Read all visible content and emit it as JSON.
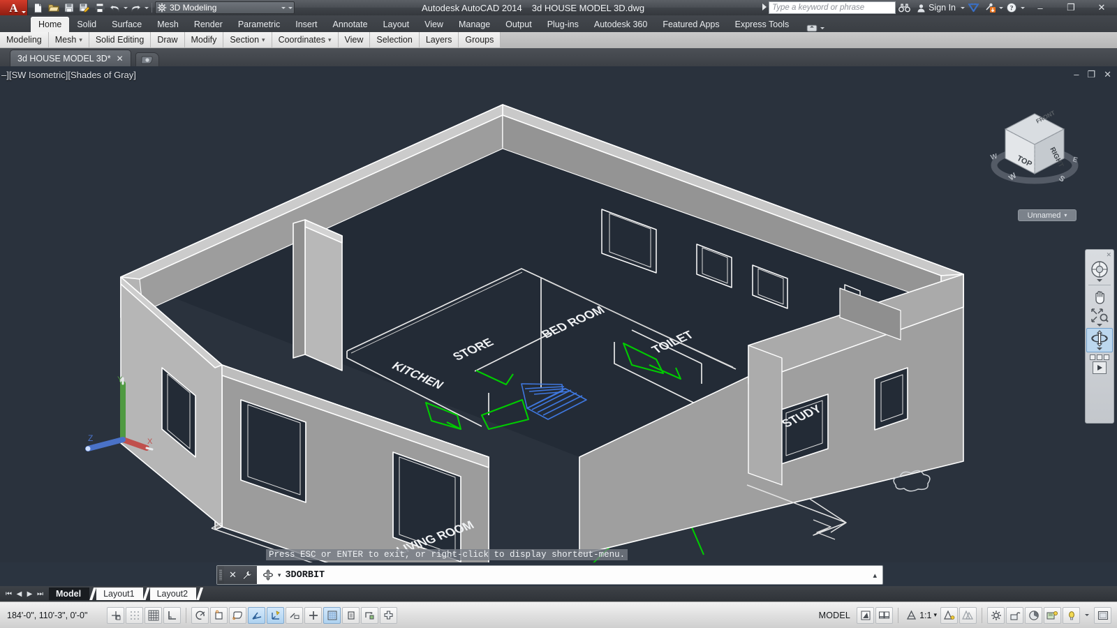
{
  "app": {
    "logo_letter": "A",
    "window_title": "Autodesk AutoCAD 2014",
    "document_title": "3d HOUSE MODEL 3D.dwg"
  },
  "quick_access": {
    "items": [
      {
        "name": "new-icon",
        "tooltip": "New"
      },
      {
        "name": "open-icon",
        "tooltip": "Open"
      },
      {
        "name": "save-icon",
        "tooltip": "Save"
      },
      {
        "name": "save-as-icon",
        "tooltip": "Save As"
      },
      {
        "name": "plot-icon",
        "tooltip": "Plot"
      },
      {
        "name": "undo-icon",
        "tooltip": "Undo"
      },
      {
        "name": "redo-icon",
        "tooltip": "Redo"
      }
    ],
    "workspace": "3D Modeling"
  },
  "infocenter": {
    "search_placeholder": "Type a keyword or phrase",
    "search_value": "",
    "binoculars_icon": "search-binoculars-icon",
    "sign_in_label": "Sign In",
    "exchange_icon": "autodesk-exchange-icon",
    "update_icon": "communication-center-icon",
    "help_icon": "help-icon"
  },
  "window_controls": {
    "minimize": "–",
    "restore": "❐",
    "close": "✕"
  },
  "ribbon": {
    "tabs": [
      {
        "label": "Home",
        "active": true
      },
      {
        "label": "Solid",
        "active": false
      },
      {
        "label": "Surface",
        "active": false
      },
      {
        "label": "Mesh",
        "active": false
      },
      {
        "label": "Render",
        "active": false
      },
      {
        "label": "Parametric",
        "active": false
      },
      {
        "label": "Insert",
        "active": false
      },
      {
        "label": "Annotate",
        "active": false
      },
      {
        "label": "Layout",
        "active": false
      },
      {
        "label": "View",
        "active": false
      },
      {
        "label": "Manage",
        "active": false
      },
      {
        "label": "Output",
        "active": false
      },
      {
        "label": "Plug-ins",
        "active": false
      },
      {
        "label": "Autodesk 360",
        "active": false
      },
      {
        "label": "Featured Apps",
        "active": false
      },
      {
        "label": "Express Tools",
        "active": false
      }
    ],
    "panels": [
      {
        "label": "Modeling",
        "has_caret": false
      },
      {
        "label": "Mesh",
        "has_caret": true
      },
      {
        "label": "Solid Editing",
        "has_caret": false
      },
      {
        "label": "Draw",
        "has_caret": false
      },
      {
        "label": "Modify",
        "has_caret": false
      },
      {
        "label": "Section",
        "has_caret": true
      },
      {
        "label": "Coordinates",
        "has_caret": true
      },
      {
        "label": "View",
        "has_caret": false
      },
      {
        "label": "Selection",
        "has_caret": false
      },
      {
        "label": "Layers",
        "has_caret": false
      },
      {
        "label": "Groups",
        "has_caret": false
      }
    ]
  },
  "file_tabs": [
    {
      "label": "3d HOUSE MODEL 3D*",
      "close": "✕",
      "active": true
    }
  ],
  "viewport": {
    "label": "–][SW Isometric][Shades of Gray]",
    "view_style": "Shades of Gray",
    "view_direction": "SW Isometric",
    "controls": {
      "minimize": "–",
      "restore": "❐",
      "close": "✕"
    },
    "background_color": "#2a323d",
    "wall_fill_color": "#9a9a9a",
    "edge_color": "#ffffff",
    "door_swing_color": "#00d000",
    "stair_color": "#2f6bd8"
  },
  "viewcube": {
    "faces": {
      "top": "TOP",
      "right": "RIGHT",
      "front": "FRONT"
    },
    "compass": {
      "n": "N",
      "e": "E",
      "s": "S",
      "w": "W"
    },
    "label": "Unnamed"
  },
  "navbar": {
    "items": [
      {
        "name": "steering-wheel-icon",
        "label": "Full Navigation Wheel",
        "selected": false,
        "has_caret": true
      },
      {
        "name": "pan-hand-icon",
        "label": "Pan",
        "selected": false,
        "has_caret": false
      },
      {
        "name": "zoom-extents-icon",
        "label": "Zoom Extents",
        "selected": false,
        "has_caret": true
      },
      {
        "name": "orbit-icon",
        "label": "Orbit",
        "selected": true,
        "has_caret": true
      },
      {
        "name": "showmotion-icon",
        "label": "ShowMotion",
        "selected": false,
        "has_caret": false
      }
    ],
    "close": "✕"
  },
  "model_labels": [
    {
      "text": "KITCHEN"
    },
    {
      "text": "STORE"
    },
    {
      "text": "BED ROOM"
    },
    {
      "text": "TOILET"
    },
    {
      "text": "STUDY"
    },
    {
      "text": "LIVING ROOM"
    }
  ],
  "ucs_icon": {
    "x_label": "X",
    "x_color": "#c0504d",
    "y_label": "Y",
    "y_color": "#4f9a41",
    "z_label": "Z",
    "z_color": "#4a72c8"
  },
  "command_line": {
    "prompt_tooltip": "Press ESC or ENTER to exit, or right-click to display shortcut-menu.",
    "close_icon": "✕",
    "settings_icon": "wrench-icon",
    "command_icon": "3dorbit-icon",
    "caret": "▾",
    "current_command": "3DORBIT",
    "expand_icon": "▴"
  },
  "layout_tabs": {
    "nav": [
      "⏮",
      "◀",
      "▶",
      "⏭"
    ],
    "tabs": [
      {
        "label": "Model",
        "active": true
      },
      {
        "label": "Layout1",
        "active": false
      },
      {
        "label": "Layout2",
        "active": false
      }
    ]
  },
  "status_bar": {
    "coordinates": "184'-0\",  110'-3\",  0'-0\"",
    "left_toggles": [
      {
        "name": "infer-constraints-icon",
        "on": false
      },
      {
        "name": "snap-mode-icon",
        "on": false
      },
      {
        "name": "grid-display-icon",
        "on": false
      },
      {
        "name": "ortho-mode-icon",
        "on": false
      },
      {
        "name": "polar-tracking-icon",
        "on": false
      },
      {
        "name": "object-snap-icon",
        "on": false
      },
      {
        "name": "3d-object-snap-icon",
        "on": false
      },
      {
        "name": "object-snap-tracking-icon",
        "on": true
      },
      {
        "name": "dynamic-ucs-icon",
        "on": true
      },
      {
        "name": "dynamic-input-icon",
        "on": false
      },
      {
        "name": "lineweight-icon",
        "on": false
      },
      {
        "name": "transparency-icon",
        "on": true
      },
      {
        "name": "selection-cycling-icon",
        "on": false
      },
      {
        "name": "annotation-monitor-icon",
        "on": false
      },
      {
        "name": "add-scale-icon",
        "on": false
      }
    ],
    "space_label": "MODEL",
    "quick_view_icons": [
      {
        "name": "quick-view-layouts-icon"
      },
      {
        "name": "quick-view-drawings-icon"
      }
    ],
    "annotation_scale": "1:1",
    "annotation_scale_caret": "▾",
    "right_toggles": [
      {
        "name": "annotation-visibility-icon"
      },
      {
        "name": "auto-scale-icon"
      },
      {
        "name": "workspace-switching-icon"
      },
      {
        "name": "toolbar-lock-icon"
      },
      {
        "name": "hardware-acceleration-icon"
      },
      {
        "name": "isolate-objects-icon"
      },
      {
        "name": "clean-screen-icon"
      },
      {
        "name": "status-menu-caret"
      },
      {
        "name": "fullscreen-icon"
      }
    ]
  }
}
